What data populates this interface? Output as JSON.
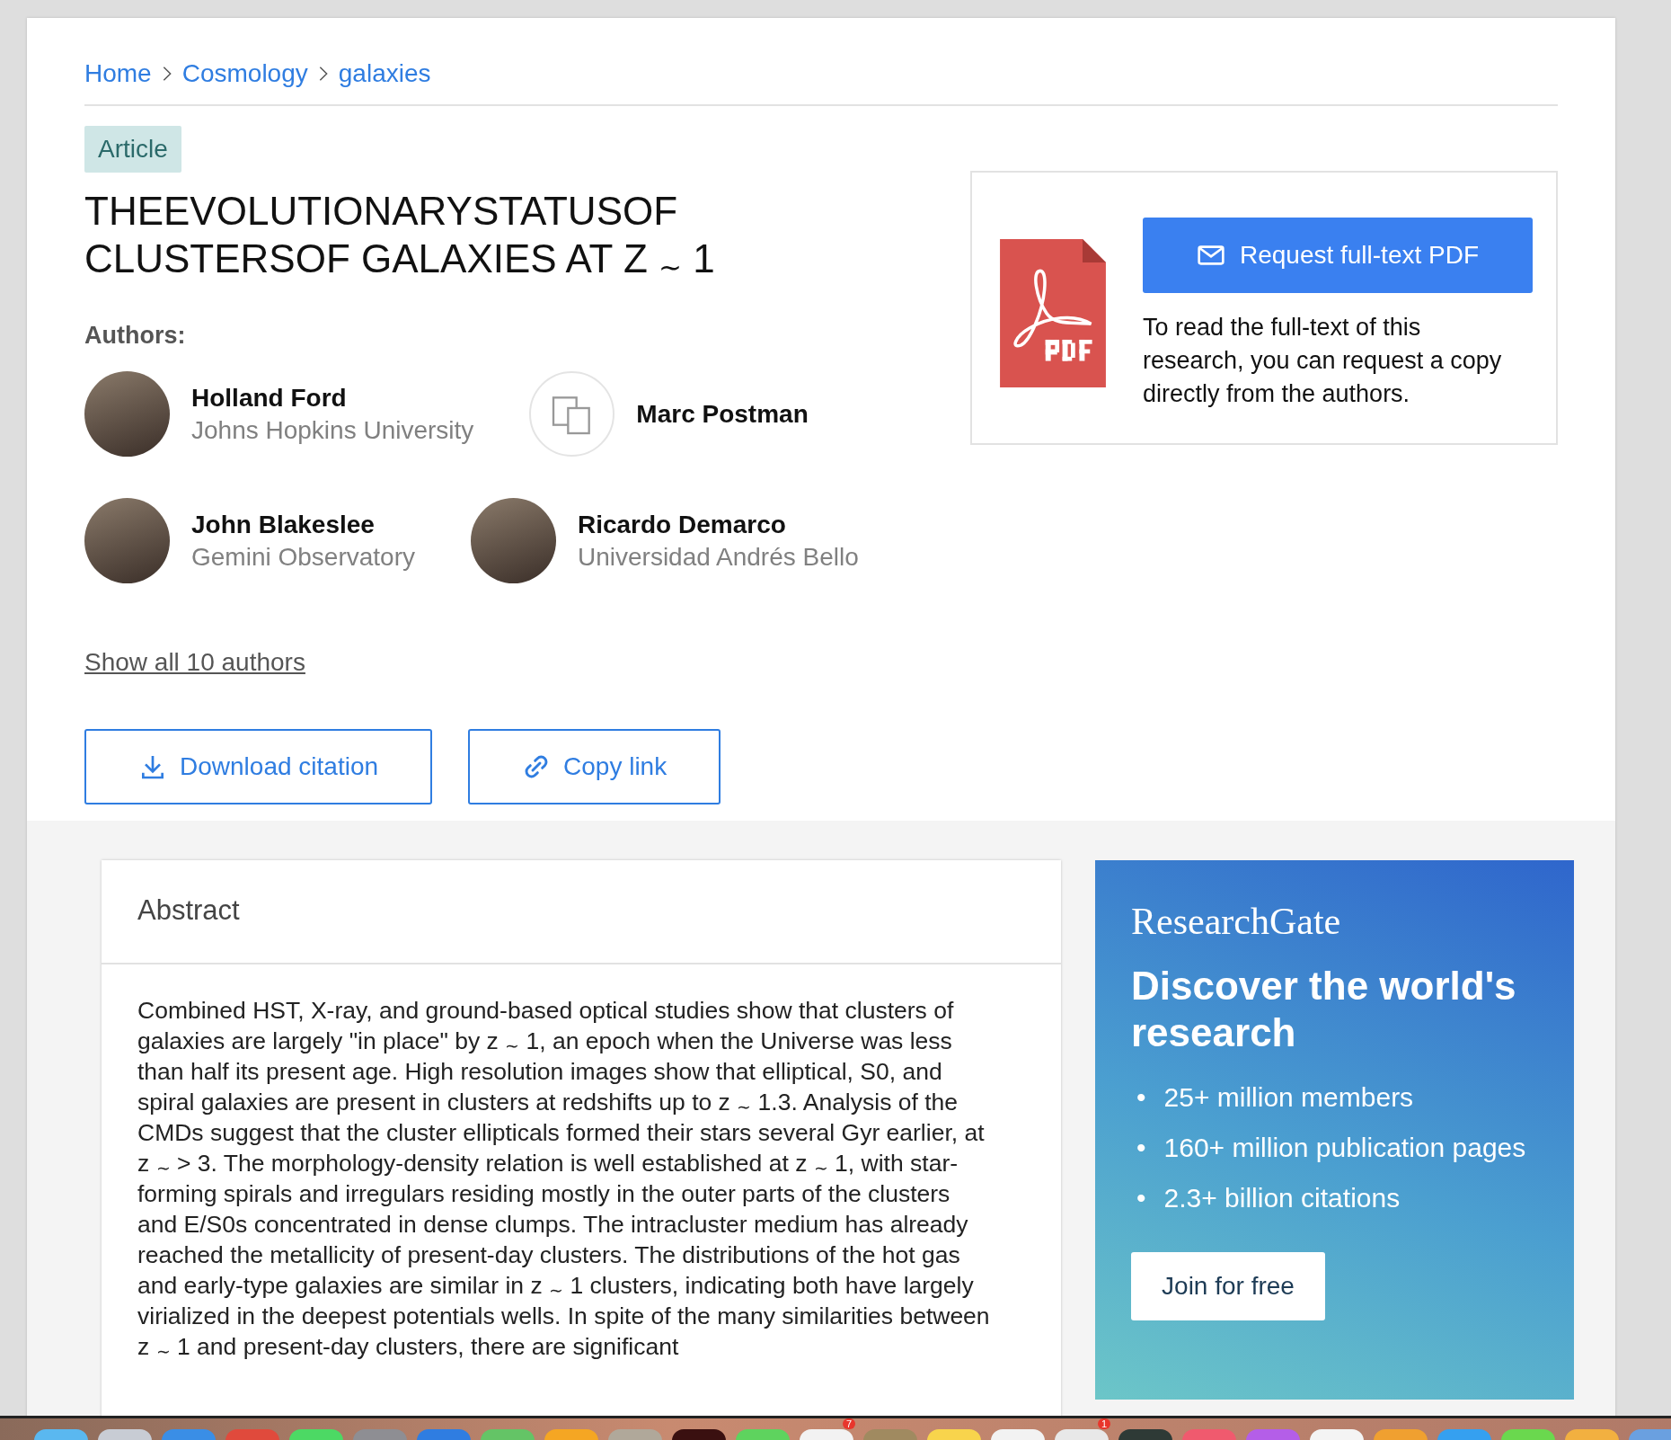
{
  "breadcrumb": [
    "Home",
    "Cosmology",
    "galaxies"
  ],
  "badge": "Article",
  "title": [
    "THEEVOLUTIONARYSTATUSOF",
    "CLUSTERSOF GALAXIES AT Z $_{∼}$ 1"
  ],
  "authors_label": "Authors:",
  "authors": [
    {
      "name": "Holland Ford",
      "affiliation": "Johns Hopkins University",
      "kind": "photo"
    },
    {
      "name": "Marc Postman",
      "kind": "placeholder"
    },
    {
      "name": "John Blakeslee",
      "affiliation": "Gemini Observatory",
      "kind": "photo"
    },
    {
      "name": "Ricardo Demarco",
      "affiliation": "Universidad Andrés Bello",
      "kind": "photo"
    }
  ],
  "show_all": "Show all 10 authors",
  "actions": [
    {
      "label": "Download citation",
      "kind": "download"
    },
    {
      "label": "Copy link",
      "kind": "link"
    }
  ],
  "request": {
    "button": "Request full-text PDF",
    "text": "To read the full-text of this research, you can request a copy directly from the authors."
  },
  "abstract": {
    "heading": "Abstract",
    "text": "Combined HST, X-ray, and ground-based optical studies show that clusters of galaxies are largely \"in place\" by z $_{∼}$ 1, an epoch when the Universe was less than half its present age. High resolution images show that elliptical, S0, and spiral galaxies are present in clusters at redshifts up to z $_{∼}$ 1.3. Analysis of the CMDs suggest that the cluster ellipticals formed their stars several Gyr earlier, at z $_{∼}$ > 3. The morphology-density relation is well established at z $_{∼}$ 1, with star- forming spirals and irregulars residing mostly in the outer parts of the clusters and E/S0s concentrated in dense clumps. The intracluster medium has already reached the metallicity of present-day clusters. The distributions of the hot gas and early-type galaxies are similar in z $_{∼}$ 1 clusters, indicating both have largely virialized in the deepest potentials wells. In spite of the many similarities between z $_{∼}$ 1 and present-day clusters, there are significant"
  },
  "promo": {
    "brand": "ResearchGate",
    "marker": "•",
    "heading": "Discover the world's research",
    "points": [
      "25+ million members",
      "160+ million publication pages",
      "2.3+ billion citations"
    ],
    "button": "Join for free"
  },
  "dock": [
    {
      "color": "#5ab8f0"
    },
    {
      "color": "#c8ccd4"
    },
    {
      "color": "#3a8ee6"
    },
    {
      "color": "#e04a3c"
    },
    {
      "color": "#4cd964"
    },
    {
      "color": "#8e8e93"
    },
    {
      "color": "#2f7de1"
    },
    {
      "color": "#64c466"
    },
    {
      "color": "#f5a623"
    },
    {
      "color": "#b0a89a"
    },
    {
      "color": "#3a1010"
    },
    {
      "color": "#5ed35e"
    },
    {
      "color": "#f2f2f2",
      "badge": "7"
    },
    {
      "color": "#a08a60"
    },
    {
      "color": "#f8d44c"
    },
    {
      "color": "#f2f2f2"
    },
    {
      "color": "#e8e8e8",
      "badge": "1"
    },
    {
      "color": "#2e3a36"
    },
    {
      "color": "#f05a6e"
    },
    {
      "color": "#b45ee8"
    },
    {
      "color": "#f4f4f4"
    },
    {
      "color": "#f0a030"
    },
    {
      "color": "#35a0f0"
    },
    {
      "color": "#6ad84e"
    },
    {
      "color": "#f2b040"
    },
    {
      "color": "#6aa0e0"
    }
  ]
}
